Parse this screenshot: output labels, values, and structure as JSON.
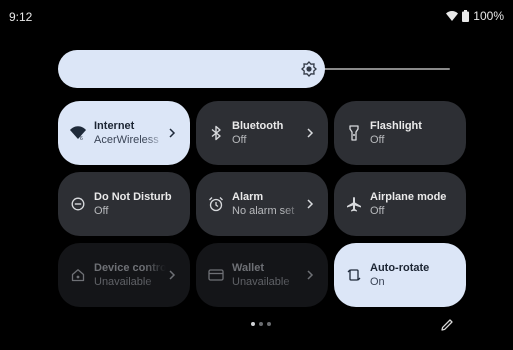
{
  "status_bar": {
    "time": "9:12",
    "battery": "100%"
  },
  "brightness": {
    "level": 0.68
  },
  "tiles": [
    {
      "title": "Internet",
      "subtitle": "AcerWireless",
      "icon": "wifi-icon",
      "state": "active",
      "chevron": true
    },
    {
      "title": "Bluetooth",
      "subtitle": "Off",
      "icon": "bluetooth-icon",
      "state": "inactive",
      "chevron": true
    },
    {
      "title": "Flashlight",
      "subtitle": "Off",
      "icon": "flashlight-icon",
      "state": "inactive",
      "chevron": false
    },
    {
      "title": "Do Not Disturb",
      "subtitle": "Off",
      "icon": "do-not-disturb-icon",
      "state": "inactive",
      "chevron": false
    },
    {
      "title": "Alarm",
      "subtitle": "No alarm set",
      "icon": "alarm-icon",
      "state": "inactive",
      "chevron": true
    },
    {
      "title": "Airplane mode",
      "subtitle": "Off",
      "icon": "airplane-icon",
      "state": "inactive",
      "chevron": false
    },
    {
      "title": "Device controls",
      "subtitle": "Unavailable",
      "icon": "home-icon",
      "state": "disabled",
      "chevron": true
    },
    {
      "title": "Wallet",
      "subtitle": "Unavailable",
      "icon": "wallet-icon",
      "state": "disabled",
      "chevron": true
    },
    {
      "title": "Auto-rotate",
      "subtitle": "On",
      "icon": "auto-rotate-icon",
      "state": "active",
      "chevron": false
    }
  ],
  "pager": {
    "page_count": 3,
    "current_page": 1
  },
  "colors": {
    "active_tile": "#dce6f7",
    "inactive_tile": "#2d2f34",
    "disabled_tile": "#141518",
    "background": "#000000"
  }
}
